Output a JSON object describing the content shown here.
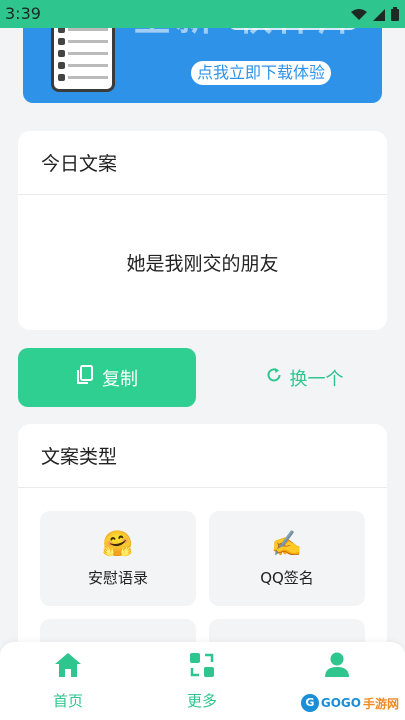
{
  "status_bar": {
    "time": "3:39",
    "icons": [
      "wifi-icon",
      "signal-icon",
      "battery-icon"
    ]
  },
  "banner": {
    "headline": "全新 软件库",
    "cta": "点我立即下载体验"
  },
  "daily_copy": {
    "title": "今日文案",
    "text": "她是我刚交的朋友"
  },
  "actions": {
    "copy_label": "复制",
    "swap_label": "换一个"
  },
  "types": {
    "title": "文案类型",
    "items": [
      {
        "emoji": "🤗",
        "label": "安慰语录"
      },
      {
        "emoji": "✍️",
        "label": "QQ签名"
      }
    ]
  },
  "bottom_nav": {
    "items": [
      {
        "label": "首页",
        "icon": "home-icon"
      },
      {
        "label": "更多",
        "icon": "more-icon"
      },
      {
        "label": "",
        "icon": "profile-icon"
      }
    ]
  },
  "watermark": {
    "text": "GOGO",
    "suffix": "手游网"
  },
  "colors": {
    "accent": "#2fce91",
    "status_bar": "#2fc58e",
    "banner": "#2e93e8",
    "background": "#f3f4f6"
  }
}
